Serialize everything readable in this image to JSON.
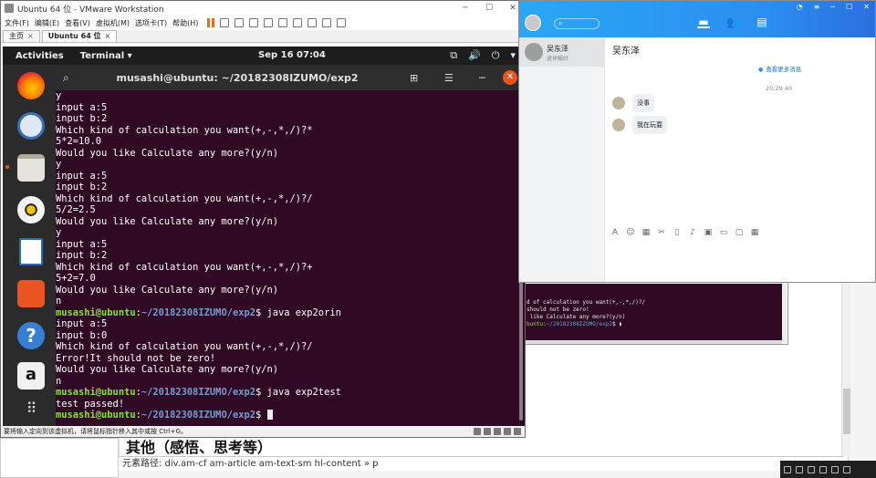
{
  "vmware": {
    "title": "Ubuntu 64 位 - VMware Workstation",
    "menu": [
      "文件(F)",
      "编辑(E)",
      "查看(V)",
      "虚拟机(M)",
      "选项卡(T)",
      "帮助(H)"
    ],
    "tabs": [
      {
        "label": "主页"
      },
      {
        "label": "Ubuntu 64 位"
      }
    ],
    "status_text": "要将输入定向到该虚拟机，请将鼠标指针移入其中或按 Ctrl+G。"
  },
  "ubuntu": {
    "activities": "Activities",
    "app_menu": "Terminal ▾",
    "clock": "Sep 16  07:04",
    "terminal_title": "musashi@ubuntu: ~/20182308IZUMO/exp2"
  },
  "terminal": {
    "lines": [
      {
        "text": "y"
      },
      {
        "text": "input a:5"
      },
      {
        "text": "input b:2"
      },
      {
        "text": "Which kind of calculation you want(+,-,*,/)?*"
      },
      {
        "text": "5*2=10.0"
      },
      {
        "text": "Would you like Calculate any more?(y/n)"
      },
      {
        "text": "y"
      },
      {
        "text": "input a:5"
      },
      {
        "text": "input b:2"
      },
      {
        "text": "Which kind of calculation you want(+,-,*,/)?/"
      },
      {
        "text": "5/2=2.5"
      },
      {
        "text": "Would you like Calculate any more?(y/n)"
      },
      {
        "text": "y"
      },
      {
        "text": "input a:5"
      },
      {
        "text": "input b:2"
      },
      {
        "text": "Which kind of calculation you want(+,-,*,/)?+"
      },
      {
        "text": "5+2=7.0"
      },
      {
        "text": "Would you like Calculate any more?(y/n)"
      },
      {
        "text": "n"
      },
      {
        "prompt_user": "musashi@ubuntu",
        "prompt_path": "~/20182308IZUMO/exp2",
        "text": " java exp2orin"
      },
      {
        "text": "input a:5"
      },
      {
        "text": "input b:0"
      },
      {
        "text": "Which kind of calculation you want(+,-,*,/)?/"
      },
      {
        "text": "Error!It should not be zero!"
      },
      {
        "text": "Would you like Calculate any more?(y/n)"
      },
      {
        "text": "n"
      },
      {
        "prompt_user": "musashi@ubuntu",
        "prompt_path": "~/20182308IZUMO/exp2",
        "text": " java exp2test"
      },
      {
        "text": "test passed!"
      },
      {
        "prompt_user": "musashi@ubuntu",
        "prompt_path": "~/20182308IZUMO/exp2",
        "text": " ",
        "cursor": true
      }
    ]
  },
  "vm2": {
    "lines": [
      "d of calculation you want(+,-,*,/)?/",
      "should not be zero!",
      " like Calculate any more?(y/n)",
      ""
    ],
    "prompt_user": "buntu",
    "prompt_path": "~/20182308IZUMO/exp2"
  },
  "chat": {
    "search_placeholder": "",
    "contact": {
      "name": "吴东泽",
      "sub": "退休鳗好"
    },
    "conversation_title": "吴东泽",
    "more_history": "查看更多消息",
    "time": "20:29:40",
    "messages": [
      {
        "text": "没事"
      },
      {
        "text": "我在玩耍"
      }
    ]
  },
  "background_page": {
    "heading": "其他（感悟、思考等）",
    "element_path": "元素路径: div.am-cf am-article am-text-sm hl-content » p"
  },
  "colors": {
    "terminal_bg": "#300a24",
    "prompt_user": "#8ae234",
    "prompt_path": "#729fcf",
    "chat_header": "#2b8ef0",
    "ubuntu_orange": "#e95420"
  }
}
